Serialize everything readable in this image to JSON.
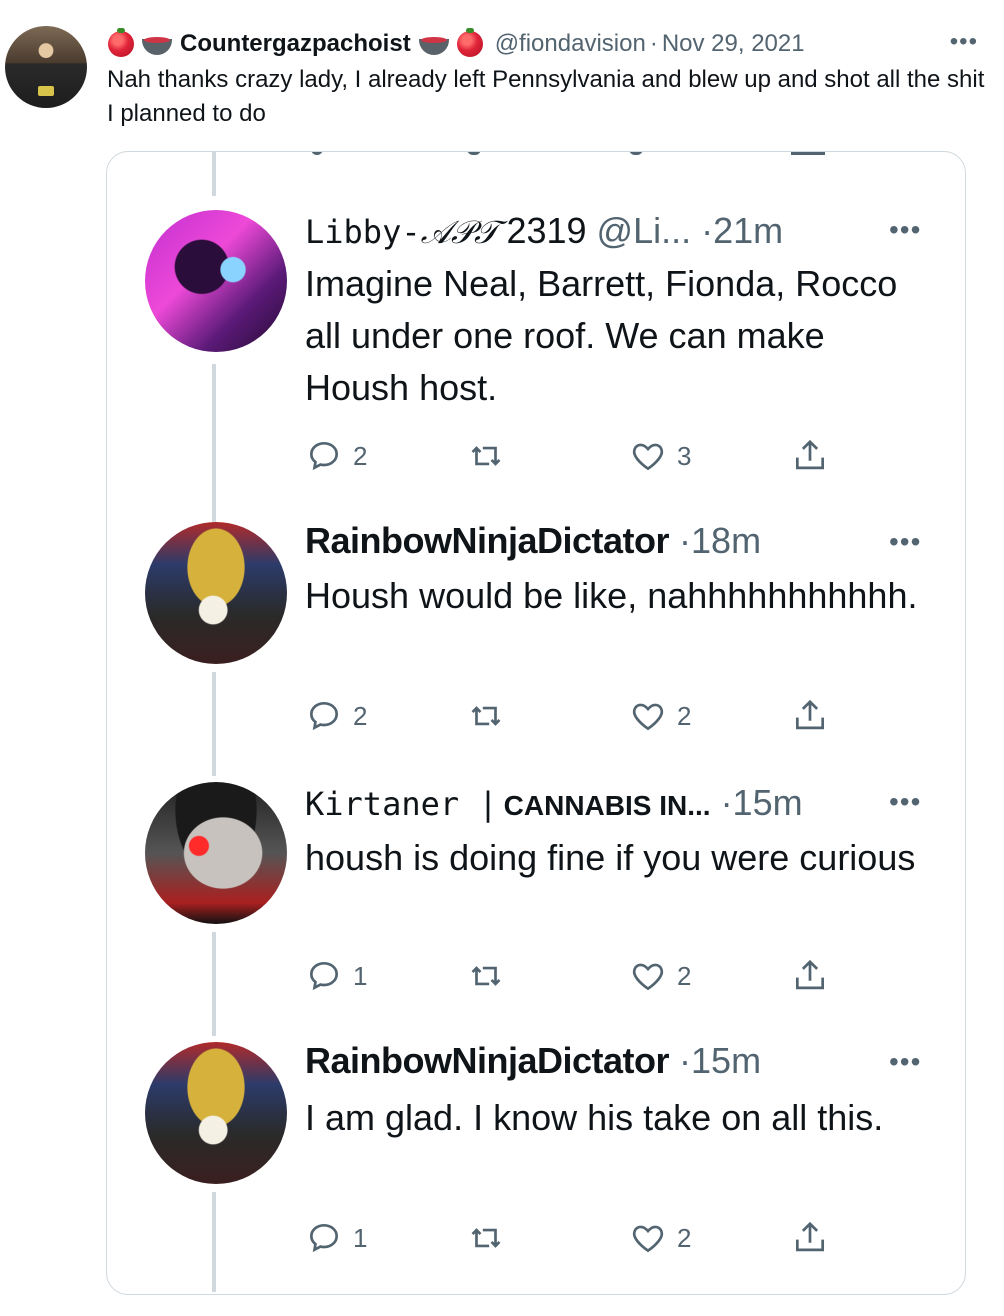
{
  "tweet": {
    "display_name": "Countergazpachoist",
    "handle": "@fiondavision",
    "separator": "·",
    "date": "Nov 29, 2021",
    "more_label": "•••",
    "text": "Nah thanks crazy lady, I already left Pennsylvania and blew up and shot all the shit I planned to do",
    "name_icons": [
      "tomato-icon",
      "gazpacho-bowl-icon",
      "gazpacho-bowl-icon",
      "tomato-icon"
    ]
  },
  "quote": {
    "replies": [
      {
        "name": "Libby-",
        "name_script": "𝒜𝒫𝒯",
        "name_suffix": "2319",
        "handle": "@Li...",
        "time": "·21m",
        "text": "Imagine Neal, Barrett, Fionda, Rocco all under one roof. We can make Housh host.",
        "replies": "2",
        "likes": "3"
      },
      {
        "name": "RainbowNinjaDictator",
        "time": "·18m",
        "text": "Housh would be like, nahhhhhhhhhhh.",
        "replies": "2",
        "likes": "2"
      },
      {
        "name": "Kirtaner |",
        "name_extra": "CANNABIS IN...",
        "time": "·15m",
        "text": "housh is doing fine if you were curious",
        "replies": "1",
        "likes": "2"
      },
      {
        "name": "RainbowNinjaDictator",
        "time": "·15m",
        "text": "I am glad.  I know his take on all this.",
        "replies": "1",
        "likes": "2"
      }
    ],
    "more_label": "•••"
  },
  "colors": {
    "text": "#0f1419",
    "muted": "#536471",
    "border": "#cfd9de"
  }
}
